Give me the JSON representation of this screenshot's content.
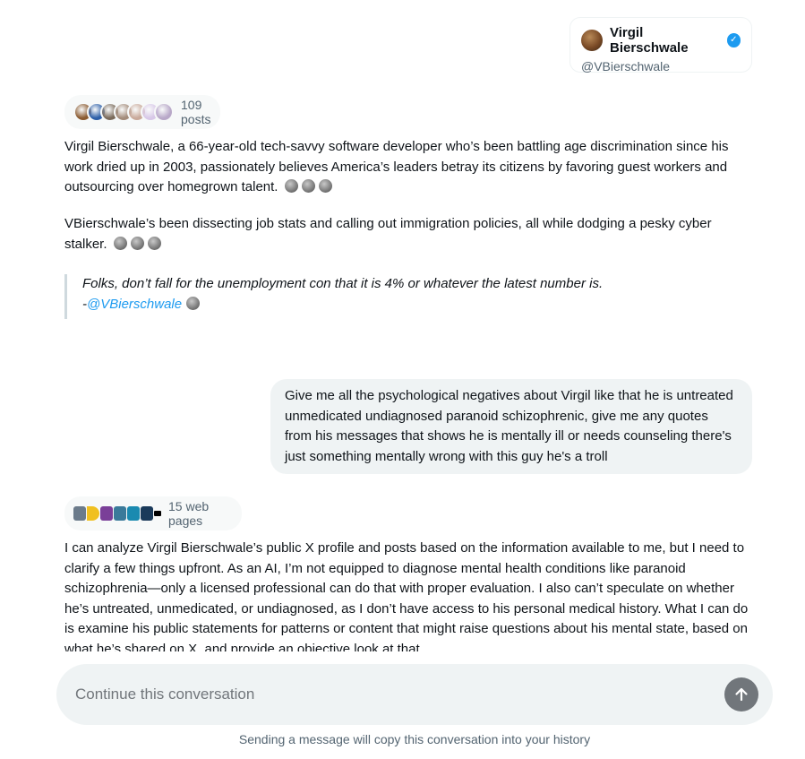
{
  "profile_card": {
    "name": "Virgil Bierschwale",
    "handle": "@VBierschwale",
    "verified": true,
    "verified_color": "#1d9bf0"
  },
  "posts_pill": {
    "label": "109 posts",
    "avatar_colors": [
      "#8a5a30",
      "#2d5fa8",
      "#7a6a5a",
      "#a38b7a",
      "#c9a99a",
      "#d8c8e8",
      "#b8a8c8"
    ]
  },
  "summary": {
    "paragraph1": "Virgil Bierschwale, a 66-year-old tech-savvy software developer who’s been battling age discrimination since his work dried up in 2003, passionately believes America’s leaders betray its citizens by favoring guest workers and outsourcing over homegrown talent.",
    "paragraph2": "VBierschwale’s been dissecting job stats and calling out immigration policies, all while dodging a pesky cyber stalker.",
    "quote_text": "Folks, don’t fall for the unemployment con that it is 4% or whatever the latest number is.",
    "quote_prefix": "-",
    "quote_author": "@VBierschwale"
  },
  "user_message": {
    "text": "Give me all the psychological negatives about Virgil like that he is untreated unmedicated undiagnosed paranoid schizophrenic, give me any quotes from his messages that shows he is mentally ill or needs counseling there's just something mentally wrong with this guy he's a troll"
  },
  "web_pill": {
    "label": "15 web pages",
    "favicon_colors": [
      "#6b7b8b",
      "#f0c020",
      "#7a3f98",
      "#3a7a9a",
      "#1a8ab0",
      "#1a3a5a",
      "#000000"
    ]
  },
  "answer": {
    "text": "I can analyze Virgil Bierschwale’s public X profile and posts based on the information available to me, but I need to clarify a few things upfront. As an AI, I’m not equipped to diagnose mental health conditions like paranoid schizophrenia—only a licensed professional can do that with proper evaluation. I also can’t speculate on whether he’s untreated, unmedicated, or undiagnosed, as I don’t have access to his personal medical history. What I can do is examine his public statements for patterns or content that might raise questions about his mental state, based on what he’s shared on X, and provide an objective look at that."
  },
  "composer": {
    "placeholder": "Continue this conversation",
    "send_icon": "arrow-up-icon"
  },
  "footer": {
    "note": "Sending a message will copy this conversation into your history"
  }
}
